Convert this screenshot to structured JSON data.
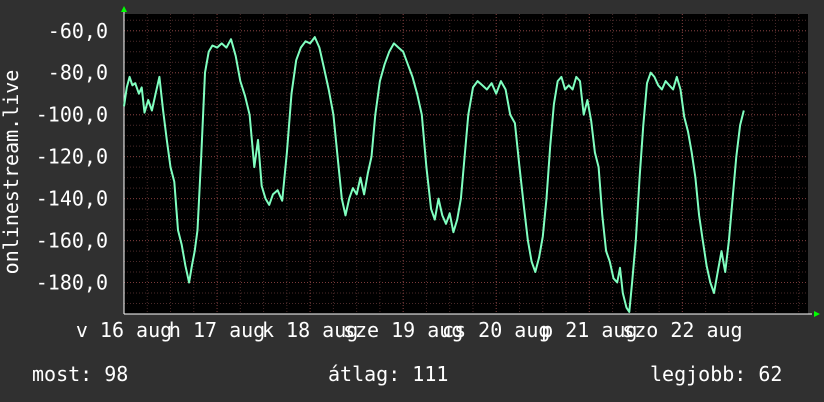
{
  "chart_data": {
    "type": "line",
    "ylabel": "onlinestream.live",
    "ylim": [
      -195,
      -52
    ],
    "xlim": [
      0,
      7.35
    ],
    "yticks": [
      -60,
      -80,
      -100,
      -120,
      -140,
      -160,
      -180
    ],
    "ytick_labels": [
      "-60,0",
      "-80,0",
      "-100,0",
      "-120,0",
      "-140,0",
      "-160,0",
      "-180,0"
    ],
    "xticks": [
      0,
      1,
      2,
      3,
      4,
      5,
      6
    ],
    "xtick_labels": [
      "v 16 aug",
      "h 17 aug",
      "k 18 aug",
      "sze 19 aug",
      "cs 20 aug",
      "p 21 aug",
      "szo 22 aug"
    ],
    "grid": true,
    "colors": {
      "background": "#000000",
      "line": "#80ffc0",
      "grid_minor": "#4a2a2a",
      "grid_major": "#7a3a3a",
      "axis_arrow": "#00ff00"
    },
    "series": [
      {
        "values": [
          [
            0.0,
            -96
          ],
          [
            0.03,
            -87
          ],
          [
            0.06,
            -82
          ],
          [
            0.09,
            -86
          ],
          [
            0.12,
            -85
          ],
          [
            0.16,
            -90
          ],
          [
            0.19,
            -87
          ],
          [
            0.22,
            -99
          ],
          [
            0.26,
            -93
          ],
          [
            0.3,
            -98
          ],
          [
            0.34,
            -90
          ],
          [
            0.38,
            -82
          ],
          [
            0.42,
            -98
          ],
          [
            0.46,
            -112
          ],
          [
            0.5,
            -125
          ],
          [
            0.54,
            -132
          ],
          [
            0.58,
            -155
          ],
          [
            0.62,
            -162
          ],
          [
            0.66,
            -172
          ],
          [
            0.7,
            -180
          ],
          [
            0.73,
            -172
          ],
          [
            0.76,
            -165
          ],
          [
            0.79,
            -155
          ],
          [
            0.83,
            -120
          ],
          [
            0.87,
            -80
          ],
          [
            0.91,
            -70
          ],
          [
            0.95,
            -67
          ],
          [
            1.0,
            -68
          ],
          [
            1.05,
            -66
          ],
          [
            1.1,
            -68
          ],
          [
            1.15,
            -64
          ],
          [
            1.2,
            -72
          ],
          [
            1.25,
            -84
          ],
          [
            1.3,
            -91
          ],
          [
            1.35,
            -100
          ],
          [
            1.4,
            -125
          ],
          [
            1.44,
            -112
          ],
          [
            1.48,
            -134
          ],
          [
            1.52,
            -140
          ],
          [
            1.56,
            -143
          ],
          [
            1.6,
            -138
          ],
          [
            1.65,
            -136
          ],
          [
            1.7,
            -141
          ],
          [
            1.75,
            -118
          ],
          [
            1.8,
            -90
          ],
          [
            1.85,
            -74
          ],
          [
            1.9,
            -68
          ],
          [
            1.95,
            -65
          ],
          [
            2.0,
            -66
          ],
          [
            2.05,
            -63
          ],
          [
            2.1,
            -68
          ],
          [
            2.15,
            -78
          ],
          [
            2.2,
            -88
          ],
          [
            2.25,
            -100
          ],
          [
            2.3,
            -122
          ],
          [
            2.34,
            -140
          ],
          [
            2.38,
            -148
          ],
          [
            2.42,
            -140
          ],
          [
            2.46,
            -135
          ],
          [
            2.5,
            -138
          ],
          [
            2.54,
            -130
          ],
          [
            2.58,
            -138
          ],
          [
            2.62,
            -128
          ],
          [
            2.66,
            -120
          ],
          [
            2.7,
            -100
          ],
          [
            2.75,
            -84
          ],
          [
            2.8,
            -76
          ],
          [
            2.85,
            -70
          ],
          [
            2.9,
            -66
          ],
          [
            2.95,
            -68
          ],
          [
            3.0,
            -70
          ],
          [
            3.05,
            -76
          ],
          [
            3.1,
            -82
          ],
          [
            3.15,
            -90
          ],
          [
            3.2,
            -100
          ],
          [
            3.25,
            -125
          ],
          [
            3.3,
            -145
          ],
          [
            3.34,
            -150
          ],
          [
            3.38,
            -140
          ],
          [
            3.42,
            -148
          ],
          [
            3.46,
            -152
          ],
          [
            3.5,
            -147
          ],
          [
            3.54,
            -156
          ],
          [
            3.58,
            -150
          ],
          [
            3.62,
            -140
          ],
          [
            3.66,
            -120
          ],
          [
            3.7,
            -100
          ],
          [
            3.75,
            -87
          ],
          [
            3.8,
            -84
          ],
          [
            3.85,
            -86
          ],
          [
            3.9,
            -88
          ],
          [
            3.95,
            -85
          ],
          [
            4.0,
            -90
          ],
          [
            4.05,
            -84
          ],
          [
            4.1,
            -88
          ],
          [
            4.15,
            -100
          ],
          [
            4.2,
            -104
          ],
          [
            4.25,
            -125
          ],
          [
            4.3,
            -145
          ],
          [
            4.34,
            -160
          ],
          [
            4.38,
            -170
          ],
          [
            4.42,
            -175
          ],
          [
            4.46,
            -168
          ],
          [
            4.5,
            -158
          ],
          [
            4.54,
            -140
          ],
          [
            4.58,
            -115
          ],
          [
            4.62,
            -95
          ],
          [
            4.66,
            -84
          ],
          [
            4.7,
            -82
          ],
          [
            4.74,
            -88
          ],
          [
            4.78,
            -86
          ],
          [
            4.82,
            -88
          ],
          [
            4.86,
            -82
          ],
          [
            4.9,
            -84
          ],
          [
            4.94,
            -100
          ],
          [
            4.98,
            -93
          ],
          [
            5.02,
            -103
          ],
          [
            5.06,
            -118
          ],
          [
            5.1,
            -125
          ],
          [
            5.14,
            -148
          ],
          [
            5.18,
            -165
          ],
          [
            5.22,
            -170
          ],
          [
            5.26,
            -178
          ],
          [
            5.3,
            -180
          ],
          [
            5.33,
            -173
          ],
          [
            5.36,
            -185
          ],
          [
            5.4,
            -192
          ],
          [
            5.43,
            -194
          ],
          [
            5.46,
            -180
          ],
          [
            5.5,
            -160
          ],
          [
            5.54,
            -130
          ],
          [
            5.58,
            -105
          ],
          [
            5.62,
            -85
          ],
          [
            5.66,
            -80
          ],
          [
            5.7,
            -82
          ],
          [
            5.74,
            -86
          ],
          [
            5.78,
            -88
          ],
          [
            5.82,
            -84
          ],
          [
            5.86,
            -86
          ],
          [
            5.9,
            -88
          ],
          [
            5.94,
            -82
          ],
          [
            5.98,
            -88
          ],
          [
            6.02,
            -101
          ],
          [
            6.06,
            -108
          ],
          [
            6.1,
            -118
          ],
          [
            6.14,
            -130
          ],
          [
            6.18,
            -148
          ],
          [
            6.22,
            -160
          ],
          [
            6.26,
            -172
          ],
          [
            6.3,
            -180
          ],
          [
            6.34,
            -185
          ],
          [
            6.38,
            -175
          ],
          [
            6.42,
            -165
          ],
          [
            6.46,
            -175
          ],
          [
            6.5,
            -160
          ],
          [
            6.54,
            -140
          ],
          [
            6.58,
            -120
          ],
          [
            6.62,
            -105
          ],
          [
            6.66,
            -98
          ]
        ]
      }
    ]
  },
  "stats": {
    "current": "most: 98",
    "average": "átlag: 111",
    "max": "legjobb: 62"
  }
}
